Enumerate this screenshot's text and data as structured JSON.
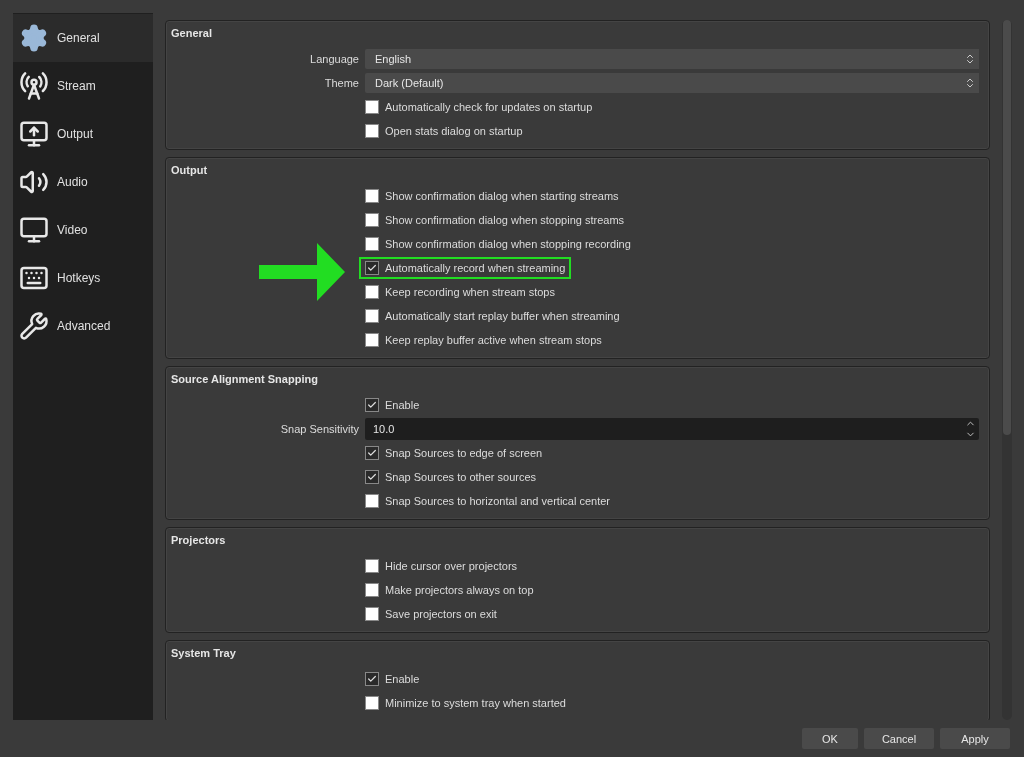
{
  "sidebar": {
    "items": [
      {
        "label": "General",
        "selected": true
      },
      {
        "label": "Stream",
        "selected": false
      },
      {
        "label": "Output",
        "selected": false
      },
      {
        "label": "Audio",
        "selected": false
      },
      {
        "label": "Video",
        "selected": false
      },
      {
        "label": "Hotkeys",
        "selected": false
      },
      {
        "label": "Advanced",
        "selected": false
      }
    ]
  },
  "sections": [
    {
      "title": "General",
      "rows": [
        {
          "kind": "select",
          "label": "Language",
          "value": "English"
        },
        {
          "kind": "select",
          "label": "Theme",
          "value": "Dark (Default)"
        },
        {
          "kind": "checkbox",
          "label": "Automatically check for updates on startup",
          "checked": false
        },
        {
          "kind": "checkbox",
          "label": "Open stats dialog on startup",
          "checked": false
        }
      ]
    },
    {
      "title": "Output",
      "rows": [
        {
          "kind": "checkbox",
          "label": "Show confirmation dialog when starting streams",
          "checked": false
        },
        {
          "kind": "checkbox",
          "label": "Show confirmation dialog when stopping streams",
          "checked": false
        },
        {
          "kind": "checkbox",
          "label": "Show confirmation dialog when stopping recording",
          "checked": false
        },
        {
          "kind": "checkbox",
          "label": "Automatically record when streaming",
          "checked": true,
          "highlighted": true
        },
        {
          "kind": "checkbox",
          "label": "Keep recording when stream stops",
          "checked": false
        },
        {
          "kind": "checkbox",
          "label": "Automatically start replay buffer when streaming",
          "checked": false
        },
        {
          "kind": "checkbox",
          "label": "Keep replay buffer active when stream stops",
          "checked": false
        }
      ]
    },
    {
      "title": "Source Alignment Snapping",
      "rows": [
        {
          "kind": "checkbox",
          "label": "Enable",
          "checked": true
        },
        {
          "kind": "spin",
          "label": "Snap Sensitivity",
          "value": "10.0"
        },
        {
          "kind": "checkbox",
          "label": "Snap Sources to edge of screen",
          "checked": true
        },
        {
          "kind": "checkbox",
          "label": "Snap Sources to other sources",
          "checked": true
        },
        {
          "kind": "checkbox",
          "label": "Snap Sources to horizontal and vertical center",
          "checked": false
        }
      ]
    },
    {
      "title": "Projectors",
      "rows": [
        {
          "kind": "checkbox",
          "label": "Hide cursor over projectors",
          "checked": false
        },
        {
          "kind": "checkbox",
          "label": "Make projectors always on top",
          "checked": false
        },
        {
          "kind": "checkbox",
          "label": "Save projectors on exit",
          "checked": false
        }
      ]
    },
    {
      "title": "System Tray",
      "rows": [
        {
          "kind": "checkbox",
          "label": "Enable",
          "checked": true
        },
        {
          "kind": "checkbox",
          "label": "Minimize to system tray when started",
          "checked": false
        }
      ]
    }
  ],
  "buttons": [
    "OK",
    "Cancel",
    "Apply"
  ]
}
